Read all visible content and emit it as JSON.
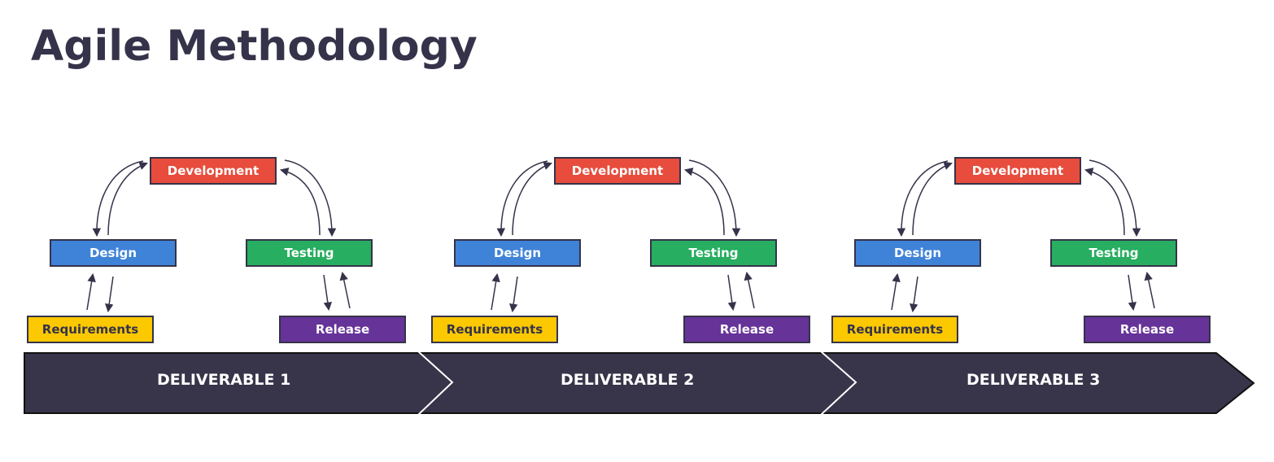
{
  "title": "Agile Methodology",
  "colors": {
    "title": "#35334a",
    "band": "#38354a",
    "development": "#e74c3c",
    "design": "#3f83d8",
    "testing": "#27ae60",
    "requirements": "#fcc800",
    "release": "#663399",
    "arrow": "#35334a"
  },
  "cycles": [
    {
      "stages": {
        "development": "Development",
        "design": "Design",
        "testing": "Testing",
        "requirements": "Requirements",
        "release": "Release"
      },
      "deliverable": "DELIVERABLE 1"
    },
    {
      "stages": {
        "development": "Development",
        "design": "Design",
        "testing": "Testing",
        "requirements": "Requirements",
        "release": "Release"
      },
      "deliverable": "DELIVERABLE 2"
    },
    {
      "stages": {
        "development": "Development",
        "design": "Design",
        "testing": "Testing",
        "requirements": "Requirements",
        "release": "Release"
      },
      "deliverable": "DELIVERABLE 3"
    }
  ],
  "flows": [
    {
      "from": "requirements",
      "to": "design"
    },
    {
      "from": "design",
      "to": "requirements"
    },
    {
      "from": "design",
      "to": "development"
    },
    {
      "from": "development",
      "to": "design"
    },
    {
      "from": "development",
      "to": "testing"
    },
    {
      "from": "testing",
      "to": "development"
    },
    {
      "from": "testing",
      "to": "release"
    },
    {
      "from": "release",
      "to": "testing"
    }
  ]
}
